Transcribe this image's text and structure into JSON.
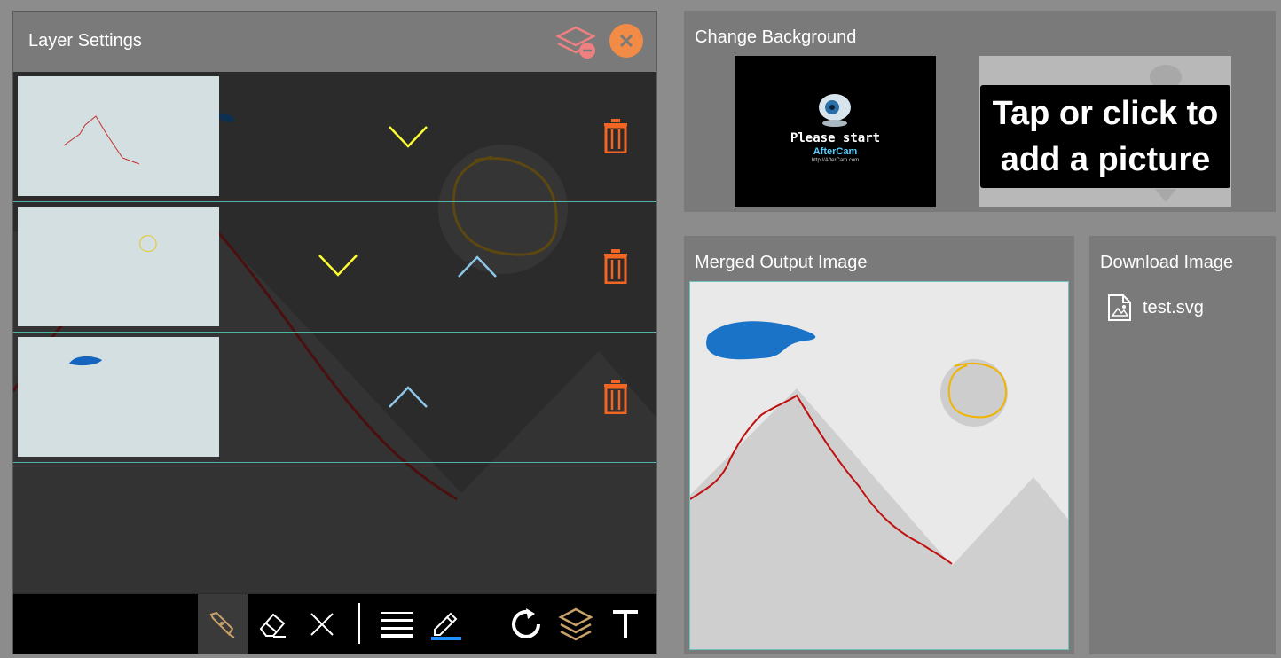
{
  "layer_panel": {
    "title": "Layer Settings",
    "remove_layer_icon": "layers-remove-icon",
    "close_icon": "close-icon",
    "layers": [
      {
        "thumb": "red-line",
        "controls": [
          "move-down"
        ]
      },
      {
        "thumb": "yellow-circle",
        "controls": [
          "move-down",
          "move-up"
        ]
      },
      {
        "thumb": "blue-scribble",
        "controls": [
          "move-up"
        ]
      }
    ]
  },
  "toolbar": {
    "tools": [
      "pen-icon",
      "eraser-icon",
      "clear-icon",
      "line-width-icon",
      "pencil-color-icon",
      "rotate-icon",
      "layers-icon",
      "text-icon"
    ],
    "active": "pen-icon"
  },
  "background_panel": {
    "title": "Change Background",
    "thumb_text_line1": "Please start",
    "thumb_text_line2": "AfterCam",
    "thumb_text_line3": "http://AfterCam.com",
    "add_picture_label": "Tap or click to add a picture"
  },
  "merged_panel": {
    "title": "Merged Output Image"
  },
  "download_panel": {
    "title": "Download Image",
    "file_name": "test.svg",
    "file_icon": "image-file-icon"
  },
  "colors": {
    "accent_orange": "#f26522",
    "close_orange": "#f28b45",
    "remove_pink": "#f08080",
    "arrow_yellow": "#ffff33",
    "arrow_blue": "#8ec7ea",
    "divider_teal": "#4fb3ad"
  }
}
